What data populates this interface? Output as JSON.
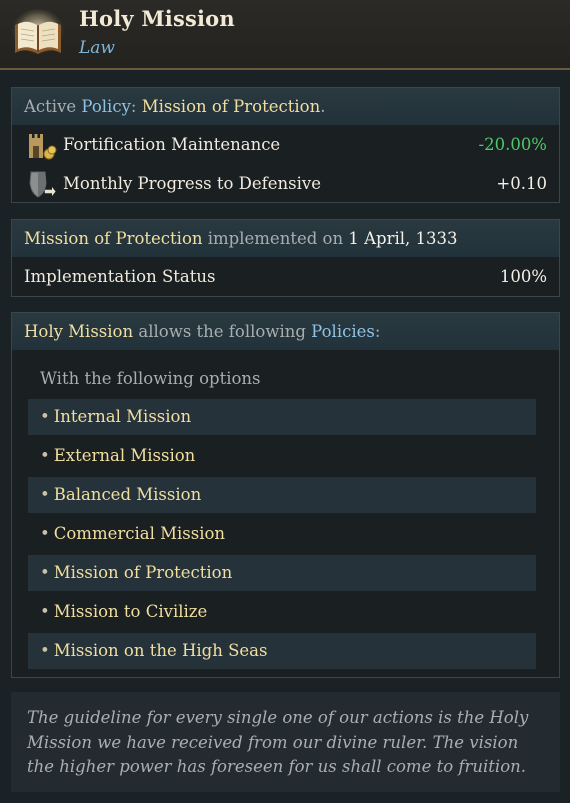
{
  "header": {
    "title": "Holy Mission",
    "subtitle": "Law",
    "icon": "book-icon"
  },
  "policy": {
    "prefix": "Active ",
    "policy_word": "Policy",
    "colon": ": ",
    "name": "Mission of Protection",
    "suffix": ".",
    "effects": [
      {
        "icon": "fortification-icon",
        "label": "Fortification Maintenance",
        "value": "-20.00%",
        "color": "#4fc76a"
      },
      {
        "icon": "shield-icon",
        "label": "Monthly Progress to Defensive",
        "value": "+0.10",
        "color": "#f4f0e6"
      }
    ]
  },
  "implementation": {
    "name": "Mission of Protection",
    "mid": " implemented on ",
    "date": "1 April, 1333",
    "status_label": "Implementation Status",
    "status_value": "100%"
  },
  "policies": {
    "law": "Holy Mission",
    "mid": " allows the following ",
    "word": "Policies",
    "colon": ":",
    "options_title": "With the following options",
    "bullet": "•",
    "options": [
      "Internal Mission",
      "External Mission",
      "Balanced Mission",
      "Commercial Mission",
      "Mission of Protection",
      "Mission to Civilize",
      "Mission on the High Seas"
    ]
  },
  "flavor": "The guideline for every single one of our actions is the Holy Mission we have received from our divine ruler. The vision the higher power has foreseen for us shall come to fruition."
}
